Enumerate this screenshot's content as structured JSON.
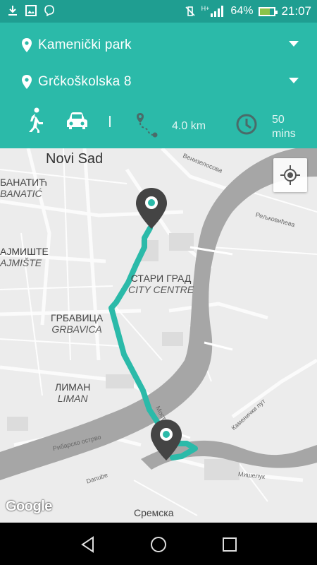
{
  "status_bar": {
    "battery_percent": "64%",
    "time": "21:07",
    "network": "H+",
    "left_icons": [
      "download-icon",
      "image-icon",
      "viber-icon"
    ]
  },
  "route": {
    "from": "Kamenički park",
    "to": "Grčkoškolska 8",
    "modes": [
      "walk",
      "car"
    ],
    "distance": "4.0 km",
    "duration_value": "50",
    "duration_unit": "mins"
  },
  "map": {
    "city_label": "Novi Sad",
    "districts": [
      {
        "cyrillic": "БАНАТИЋ",
        "latin": "BANATIĆ"
      },
      {
        "cyrillic": "АЈМИШТЕ",
        "latin": "AJMIŠTE"
      },
      {
        "cyrillic": "СТАРИ ГРАД",
        "latin": "CITY CENTRE"
      },
      {
        "cyrillic": "ГРБАВИЦА",
        "latin": "GRBAVICA"
      },
      {
        "cyrillic": "ЛИМАН",
        "latin": "LIMAN"
      },
      {
        "cyrillic": "Сремска",
        "latin": ""
      }
    ],
    "streets": [
      "Венизелосова",
      "Рељковићева",
      "Каменички пут",
      "Мишелук",
      "Рибарско острво",
      "Danube",
      "Мост"
    ],
    "attribution": "Google"
  },
  "colors": {
    "header": "#2bbaa9",
    "status": "#1f9e91",
    "route": "#2bbaa9",
    "river": "#a6a6a6"
  }
}
